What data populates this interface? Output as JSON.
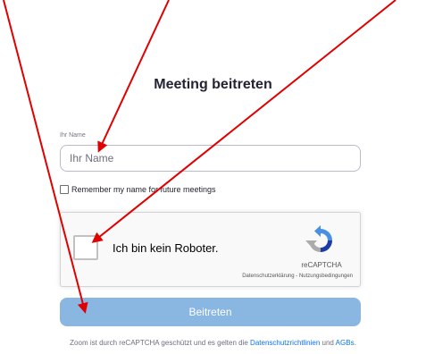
{
  "page": {
    "title": "Meeting beitreten"
  },
  "name_field": {
    "label": "Ihr Name",
    "placeholder": "Ihr Name"
  },
  "remember": {
    "label": "Remember my name for future meetings",
    "checked": false
  },
  "recaptcha": {
    "checkbox_text": "Ich bin kein Roboter.",
    "brand": "reCAPTCHA",
    "privacy_link": "Datenschutzerklärung",
    "separator": " - ",
    "terms_link": "Nutzungsbedingungen",
    "checked": false
  },
  "join_button": {
    "label": "Beitreten",
    "color": "#8ab6e2"
  },
  "footer": {
    "text_before": "Zoom ist durch reCAPTCHA geschützt und es gelten die ",
    "privacy_link": "Datenschutzrichtlinien",
    "text_middle": " und ",
    "terms_link": "AGBs",
    "text_after": "."
  },
  "annotations": {
    "arrow_color": "#e00000",
    "icons": [
      "red-arrow-icon",
      "recaptcha-logo-icon"
    ]
  }
}
